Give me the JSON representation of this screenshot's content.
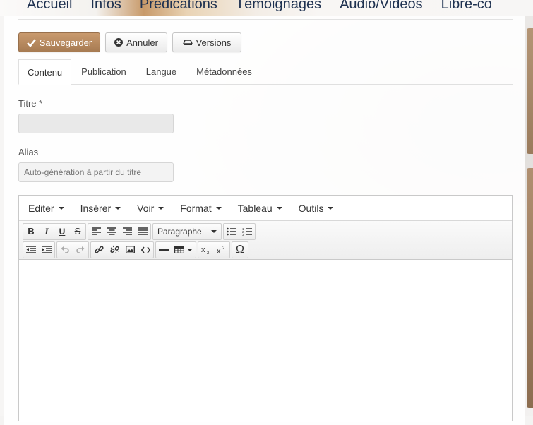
{
  "nav": {
    "items": [
      "Accueil",
      "Infos",
      "Prédications",
      "Témoignages",
      "Audio/Vidéos",
      "Libre-co"
    ]
  },
  "toolbar": {
    "save_label": "Sauvegarder",
    "cancel_label": "Annuler",
    "versions_label": "Versions"
  },
  "tabs": [
    "Contenu",
    "Publication",
    "Langue",
    "Métadonnées"
  ],
  "form": {
    "title_label": "Titre *",
    "title_value": "",
    "alias_label": "Alias",
    "alias_placeholder": "Auto-génération à partir du titre"
  },
  "editor": {
    "menus": [
      "Editer",
      "Insérer",
      "Voir",
      "Format",
      "Tableau",
      "Outils"
    ],
    "format_select": "Paragraphe",
    "content": ""
  },
  "colors": {
    "accent": "#b3875e",
    "nav_text": "#1e3150"
  }
}
